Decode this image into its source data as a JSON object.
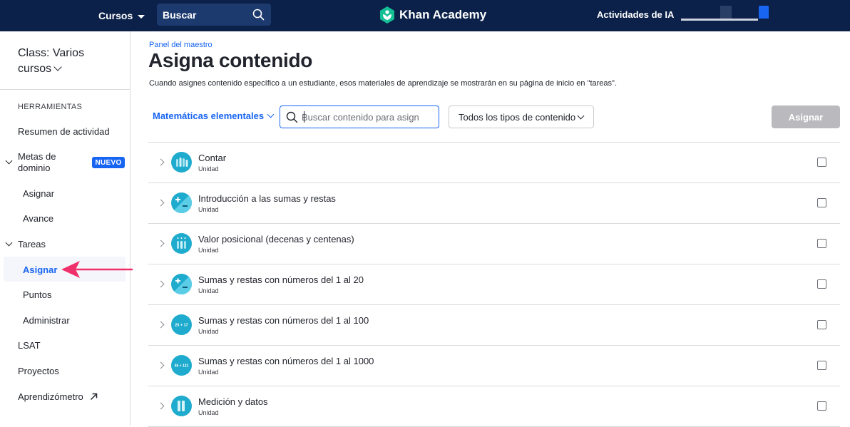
{
  "topnav": {
    "courses_label": "Cursos",
    "search_label": "Buscar",
    "logo_text": "Khan Academy",
    "ai_label": "Actividades de IA",
    "bg_color": "#0b2149"
  },
  "sidebar": {
    "class_title": "Class: Varios cursos",
    "tools_heading": "HERRAMIENTAS",
    "items": {
      "activity": "Resumen de actividad",
      "mastery": "Metas de dominio",
      "new_badge": "NUEVO",
      "mastery_assign": "Asignar",
      "mastery_progress": "Avance",
      "tasks": "Tareas",
      "tasks_assign": "Asignar",
      "tasks_points": "Puntos",
      "tasks_admin": "Administrar",
      "lsat": "LSAT",
      "projects": "Proyectos",
      "learnometer": "Aprendizómetro"
    }
  },
  "main": {
    "breadcrumb": "Panel del maestro",
    "title": "Asigna contenido",
    "description": "Cuando asignes contenido específico a un estudiante, esos materiales de aprendizaje se mostrarán en su página de inicio en \"tareas\".",
    "subject": "Matemáticas elementales",
    "search_placeholder": "Buscar contenido para asign",
    "content_type": "Todos los tipos de contenido",
    "assign_button": "Asignar"
  },
  "units": [
    {
      "title": "Contar",
      "type": "Unidad",
      "icon": "counting-icon"
    },
    {
      "title": "Introducción a las sumas y restas",
      "type": "Unidad",
      "icon": "plus-minus-icon"
    },
    {
      "title": "Valor posicional (decenas y centenas)",
      "type": "Unidad",
      "icon": "place-value-icon"
    },
    {
      "title": "Sumas y restas con números del 1 al 20",
      "type": "Unidad",
      "icon": "plus-minus-icon"
    },
    {
      "title": "Sumas y restas con números del 1 al 100",
      "type": "Unidad",
      "icon": "sum-icon",
      "icon_text": "23 + 17"
    },
    {
      "title": "Sumas y restas con números del 1 al 1000",
      "type": "Unidad",
      "icon": "sum-icon",
      "icon_text": "46 + 121"
    },
    {
      "title": "Medición y datos",
      "type": "Unidad",
      "icon": "measure-icon"
    }
  ],
  "colors": {
    "accent": "#1865f2",
    "icon_teal": "#14bf96",
    "icon_blue": "#1fabcd",
    "arrow_pink": "#f0306b",
    "disabled_button": "#bababe"
  }
}
